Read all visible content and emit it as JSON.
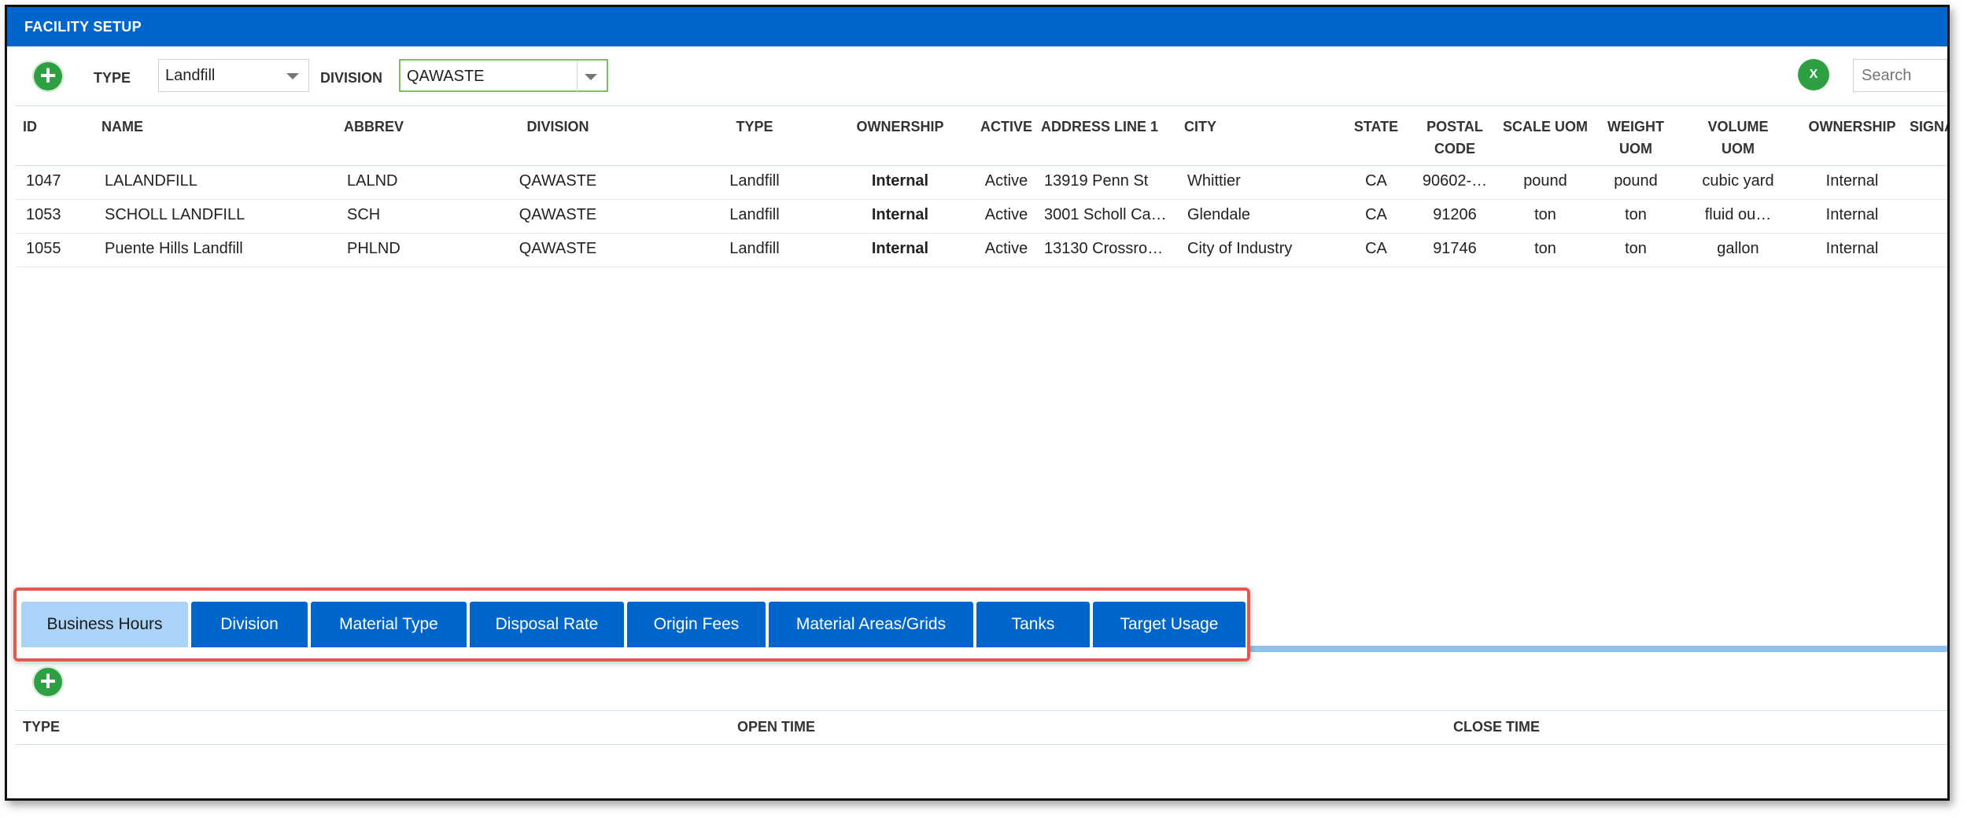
{
  "app": {
    "title": "FACILITY SETUP"
  },
  "toolbar": {
    "type_label": "TYPE",
    "type_value": "Landfill",
    "division_label": "DIVISION",
    "division_value": "QAWASTE",
    "excel_icon_glyph": "X",
    "search_placeholder": "Search"
  },
  "grid": {
    "columns": [
      "ID",
      "NAME",
      "ABBREV",
      "DIVISION",
      "TYPE",
      "OWNERSHIP",
      "ACTIVE",
      "ADDRESS LINE 1",
      "CITY",
      "STATE",
      "POSTAL CODE",
      "SCALE UOM",
      "WEIGHT UOM",
      "VOLUME UOM",
      "OWNERSHIP",
      "SIGNA"
    ],
    "column_lines": {
      "postal": [
        "POSTAL",
        "CODE"
      ],
      "weight": [
        "WEIGHT",
        "UOM"
      ],
      "volume": [
        "VOLUME",
        "UOM"
      ]
    },
    "rows": [
      {
        "id": "1047",
        "name": "LALANDFILL",
        "abbrev": "LALND",
        "division": "QAWASTE",
        "type": "Landfill",
        "ownership": "Internal",
        "active": "Active",
        "address": "13919 Penn St",
        "city": "Whittier",
        "state": "CA",
        "postal": "90602-…",
        "scale_uom": "pound",
        "weight_uom": "pound",
        "volume_uom": "cubic yard",
        "ownership2": "Internal"
      },
      {
        "id": "1053",
        "name": "SCHOLL LANDFILL",
        "abbrev": "SCH",
        "division": "QAWASTE",
        "type": "Landfill",
        "ownership": "Internal",
        "active": "Active",
        "address": "3001 Scholl Ca…",
        "city": "Glendale",
        "state": "CA",
        "postal": "91206",
        "scale_uom": "ton",
        "weight_uom": "ton",
        "volume_uom": "fluid ou…",
        "ownership2": "Internal"
      },
      {
        "id": "1055",
        "name": "Puente Hills Landfill",
        "abbrev": "PHLND",
        "division": "QAWASTE",
        "type": "Landfill",
        "ownership": "Internal",
        "active": "Active",
        "address": "13130 Crossroa…",
        "city": "City of Industry",
        "state": "CA",
        "postal": "91746",
        "scale_uom": "ton",
        "weight_uom": "ton",
        "volume_uom": "gallon",
        "ownership2": "Internal"
      }
    ]
  },
  "tabs": [
    {
      "label": "Business Hours",
      "selected": true
    },
    {
      "label": "Division",
      "selected": false
    },
    {
      "label": "Material Type",
      "selected": false
    },
    {
      "label": "Disposal Rate",
      "selected": false
    },
    {
      "label": "Origin Fees",
      "selected": false
    },
    {
      "label": "Material Areas/Grids",
      "selected": false
    },
    {
      "label": "Tanks",
      "selected": false
    },
    {
      "label": "Target Usage",
      "selected": false
    }
  ],
  "business_hours": {
    "columns": [
      "TYPE",
      "OPEN TIME",
      "CLOSE TIME"
    ]
  },
  "colors": {
    "titlebar": "#0066cc",
    "tab": "#0066cc",
    "tab_selected": "#a9d4f7",
    "add_button": "#2ea043",
    "highlight_border": "#e3584f"
  },
  "icons": {
    "add": "plus-circle-icon",
    "excel": "excel-export-icon",
    "dropdown": "chevron-down-icon"
  }
}
